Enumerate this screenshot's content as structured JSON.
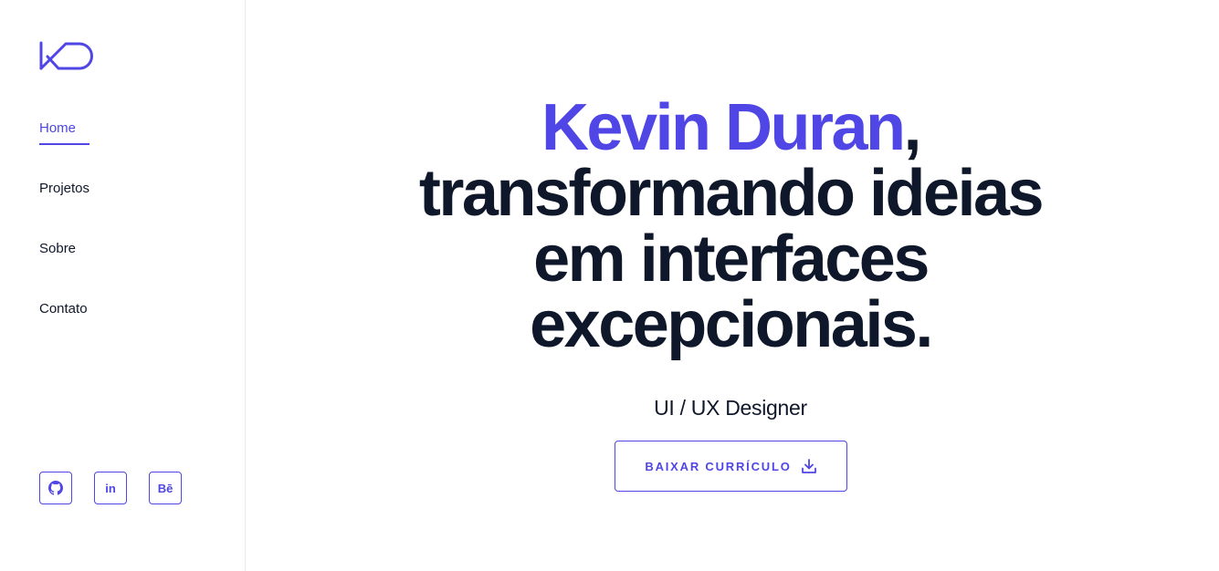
{
  "brand": {
    "logo_text": "KD",
    "accent_color": "#4f46e5",
    "text_color": "#0f172a"
  },
  "nav": {
    "items": [
      {
        "label": "Home",
        "active": true
      },
      {
        "label": "Projetos",
        "active": false
      },
      {
        "label": "Sobre",
        "active": false
      },
      {
        "label": "Contato",
        "active": false
      }
    ]
  },
  "socials": [
    {
      "icon": "github-icon"
    },
    {
      "icon": "linkedin-icon",
      "label": "in"
    },
    {
      "icon": "behance-icon",
      "label": "Bē"
    }
  ],
  "hero": {
    "name": "Kevin Duran",
    "name_suffix": ",",
    "line2": "transformando ideias",
    "line3": "em interfaces",
    "line4": "excepcionais.",
    "subtitle": "UI / UX Designer",
    "cta_label": "BAIXAR CURRÍCULO",
    "cta_icon": "download-icon"
  }
}
